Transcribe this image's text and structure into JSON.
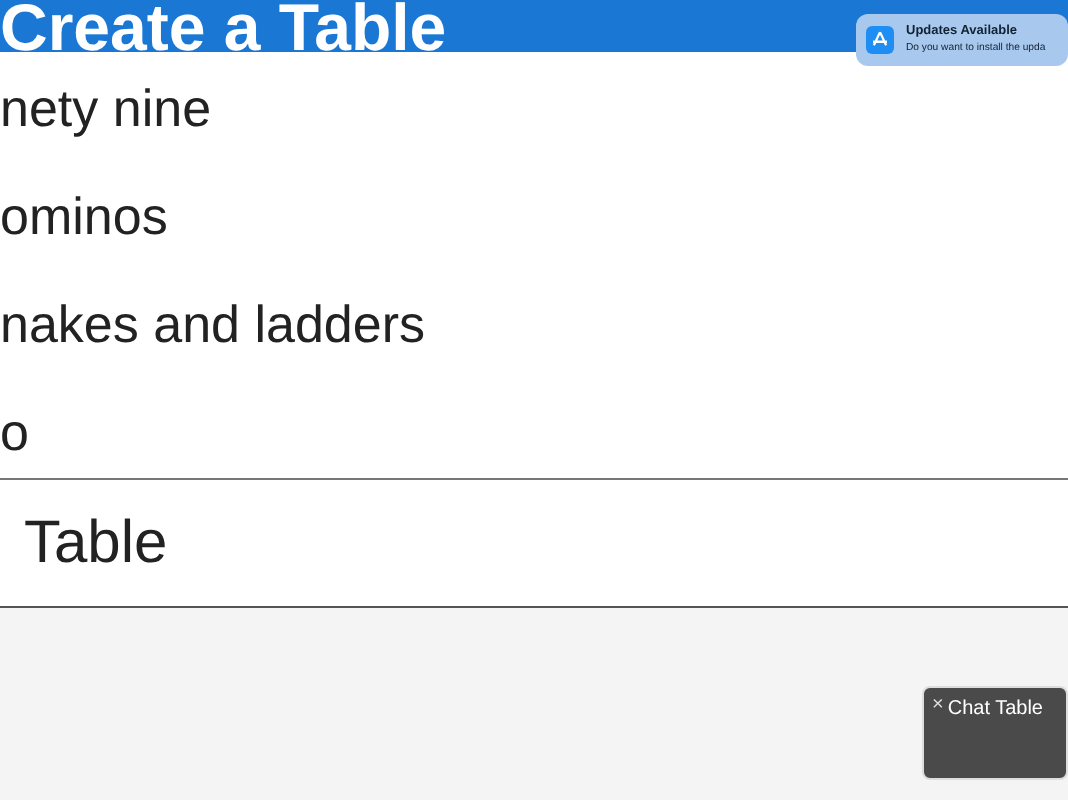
{
  "header": {
    "title": "Create a Table"
  },
  "items": [
    {
      "label": "nety nine"
    },
    {
      "label": "ominos"
    },
    {
      "label": "nakes and ladders"
    },
    {
      "label": "o"
    }
  ],
  "action": {
    "label": "Table"
  },
  "notification": {
    "title": "Updates Available",
    "message": "Do you want to install the upda"
  },
  "chat_popup": {
    "close": "×",
    "title": "Chat Table"
  }
}
